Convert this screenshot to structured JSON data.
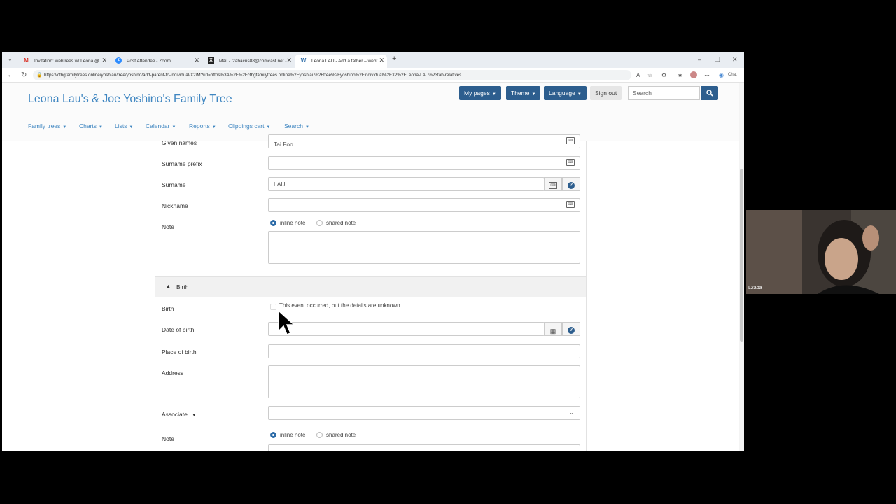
{
  "browser": {
    "tabs": [
      {
        "title": "Invitation: webtrees w/ Leona @",
        "icon": "gmail-icon",
        "active": false
      },
      {
        "title": "Post Attendee - Zoom",
        "icon": "zoom-icon",
        "active": false
      },
      {
        "title": "Mail - l2abacus88@comcast.net -",
        "icon": "x-mail-icon",
        "active": false
      },
      {
        "title": "Leona LAU - Add a father – webt",
        "icon": "webtrees-icon",
        "active": true
      }
    ],
    "url": "https://cfhgfamilytrees.online/yoshlau/tree/yoshino/add-parent-to-individual/X2/M?url=https%3A%2F%2Fcfhgfamilytrees.online%2Fyoshlau%2Ftree%2Fyoshino%2Findividual%2FX2%2FLeona-LAU%23tab-relatives",
    "chat_label": "Chat"
  },
  "site": {
    "title": "Leona Lau's & Joe Yoshino's Family Tree",
    "header_buttons": {
      "my_pages": "My pages",
      "theme": "Theme",
      "language": "Language",
      "sign_out": "Sign out"
    },
    "search_placeholder": "Search",
    "menu": [
      "Family trees",
      "Charts",
      "Lists",
      "Calendar",
      "Reports",
      "Clippings cart",
      "Search"
    ]
  },
  "form": {
    "given_names": {
      "label": "Given names",
      "value": "Tai Foo"
    },
    "surname_prefix": {
      "label": "Surname prefix",
      "value": ""
    },
    "surname": {
      "label": "Surname",
      "value": "LAU"
    },
    "nickname": {
      "label": "Nickname",
      "value": ""
    },
    "note": {
      "label": "Note",
      "inline": "inline note",
      "shared": "shared note"
    },
    "birth_section": {
      "title": "Birth"
    },
    "birth": {
      "label": "Birth",
      "checkbox": "This event occurred, but the details are unknown."
    },
    "date_of_birth": {
      "label": "Date of birth",
      "value": ""
    },
    "place_of_birth": {
      "label": "Place of birth",
      "value": ""
    },
    "address": {
      "label": "Address"
    },
    "associate": {
      "label": "Associate"
    },
    "note2": {
      "label": "Note",
      "inline": "inline note",
      "shared": "shared note"
    }
  },
  "webcam": {
    "name": "L2aba"
  }
}
